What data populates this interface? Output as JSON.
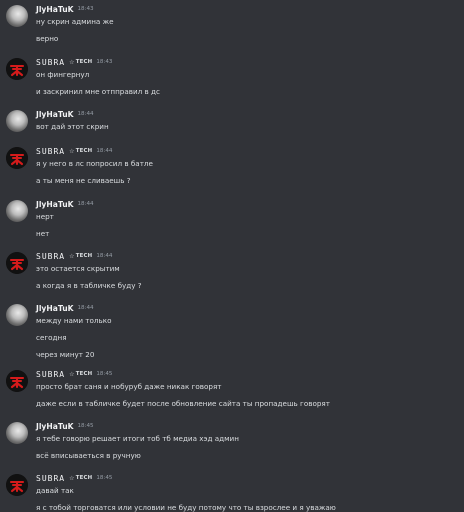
{
  "users": {
    "jly": {
      "name": "JlyHaTuK"
    },
    "sub": {
      "name": "SUBRA",
      "tag_label": "TECH",
      "tag_icon": "☆"
    }
  },
  "groups": [
    {
      "user": "jly",
      "time": "18:43",
      "lines": [
        "ну скрин админа же",
        "верно"
      ]
    },
    {
      "user": "sub",
      "time": "18:43",
      "lines": [
        "он фингернул",
        "и заскринил мне отпправил в дс"
      ]
    },
    {
      "user": "jly",
      "time": "18:44",
      "lines": [
        "вот дай этот скрин"
      ]
    },
    {
      "user": "sub",
      "time": "18:44",
      "lines": [
        "я у него в лс попросил в батле",
        "а ты меня не сливаешь ?"
      ]
    },
    {
      "user": "jly",
      "time": "18:44",
      "lines": [
        "нерт",
        "нет"
      ]
    },
    {
      "user": "sub",
      "time": "18:44",
      "lines": [
        "это остается скрытим",
        "а когда я в табличке буду ?"
      ]
    },
    {
      "user": "jly",
      "time": "18:44",
      "lines": [
        "между нами только",
        "сегодня",
        "через минут 20"
      ]
    },
    {
      "user": "sub",
      "time": "18:45",
      "lines": [
        "просто брат саня и нобуруб даже никак говорят",
        "даже если в табличке будет после обновление сайта ты пропадешь говорят"
      ]
    },
    {
      "user": "jly",
      "time": "18:45",
      "lines": [
        "я тебе говорю решает итоги тоб тб медиа хэд админ",
        "всё вписываеться в ручную"
      ]
    },
    {
      "user": "sub",
      "time": "18:45",
      "lines": [
        "давай так",
        "я с тобой торговатся или условии не буду потому что ты взрослее и я уважаю"
      ]
    }
  ]
}
